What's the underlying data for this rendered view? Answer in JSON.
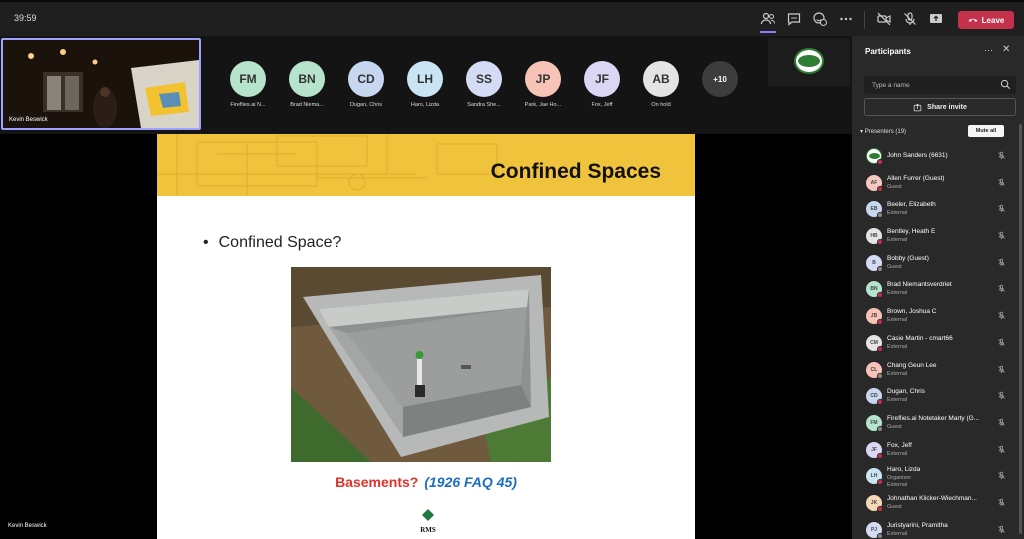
{
  "meeting": {
    "timer": "39:59",
    "leave_label": "Leave"
  },
  "colors": {
    "accent": "#7f85f5",
    "leave": "#c4314b",
    "slide_header": "#f0c33c",
    "caption_red": "#e0312b",
    "caption_blue": "#1a6ec2"
  },
  "self_tile": {
    "name": "Kevin Beswick"
  },
  "strip": {
    "avatars": [
      {
        "initials": "FM",
        "name": "Fireflies.ai N...",
        "color": "#b5e3cc"
      },
      {
        "initials": "BN",
        "name": "Brad Niema...",
        "color": "#b5e3cc"
      },
      {
        "initials": "CD",
        "name": "Dugan, Chris",
        "color": "#c7d7f0"
      },
      {
        "initials": "LH",
        "name": "Haro, Lizda",
        "color": "#c9e4f3"
      },
      {
        "initials": "SS",
        "name": "Sandra She...",
        "color": "#d4dcf5"
      },
      {
        "initials": "JP",
        "name": "Park, Jae Ho...",
        "color": "#f6c3b6"
      },
      {
        "initials": "JF",
        "name": "Fox, Jeff",
        "color": "#dcd6f5"
      },
      {
        "initials": "AB",
        "name": "On hold",
        "color": "#e4e4e4"
      }
    ],
    "more": "+10"
  },
  "stage": {
    "presenter_name": "Kevin Beswick"
  },
  "slide": {
    "title": "Confined Spaces",
    "bullet": "Confined Space?",
    "caption_red": "Basements?",
    "caption_blue": "(1926 FAQ 45)",
    "logo_text": "RMS"
  },
  "panel": {
    "title": "Participants",
    "search_placeholder": "Type a name",
    "share_label": "Share invite",
    "presenters_label": "Presenters (19)",
    "mute_all": "Mute all",
    "participants": [
      {
        "initials": "",
        "name": "John Sanders (6631)",
        "role": "",
        "color": "#ffffff",
        "logo": true
      },
      {
        "initials": "AF",
        "name": "Allen Furrer (Guest)",
        "role": "Guest",
        "color": "#f6c9c0"
      },
      {
        "initials": "EB",
        "name": "Beeler, Elizabeth",
        "role": "External",
        "color": "#c7d7f0"
      },
      {
        "initials": "HB",
        "name": "Bentley, Heath E",
        "role": "External",
        "color": "#e4e4e4"
      },
      {
        "initials": "B",
        "name": "Bobby (Guest)",
        "role": "Guest",
        "color": "#d4dcf5"
      },
      {
        "initials": "BN",
        "name": "Brad Niemantsverdriet",
        "role": "External",
        "color": "#b5e3cc"
      },
      {
        "initials": "JB",
        "name": "Brown, Joshua C",
        "role": "External",
        "color": "#f6c3b6"
      },
      {
        "initials": "CM",
        "name": "Casie Martin - cmart66",
        "role": "External",
        "color": "#e4e4e4"
      },
      {
        "initials": "CL",
        "name": "Chang Geun Lee",
        "role": "External",
        "color": "#f6c3b6"
      },
      {
        "initials": "CD",
        "name": "Dugan, Chris",
        "role": "External",
        "color": "#c7d7f0"
      },
      {
        "initials": "FM",
        "name": "Fireflies.ai Notetaker Marty (G...",
        "role": "Guest",
        "color": "#b5e3cc"
      },
      {
        "initials": "JF",
        "name": "Fox, Jeff",
        "role": "External",
        "color": "#dcd6f5"
      },
      {
        "initials": "LH",
        "name": "Haro, Lizda",
        "role": "Organizer\nExternal",
        "color": "#c9e4f3"
      },
      {
        "initials": "JK",
        "name": "Johnathan Klicker-Wiechman...",
        "role": "Guest",
        "color": "#f6d6b6"
      },
      {
        "initials": "PJ",
        "name": "Juristyarini, Pramitha",
        "role": "External",
        "color": "#d4dcf5"
      }
    ]
  }
}
